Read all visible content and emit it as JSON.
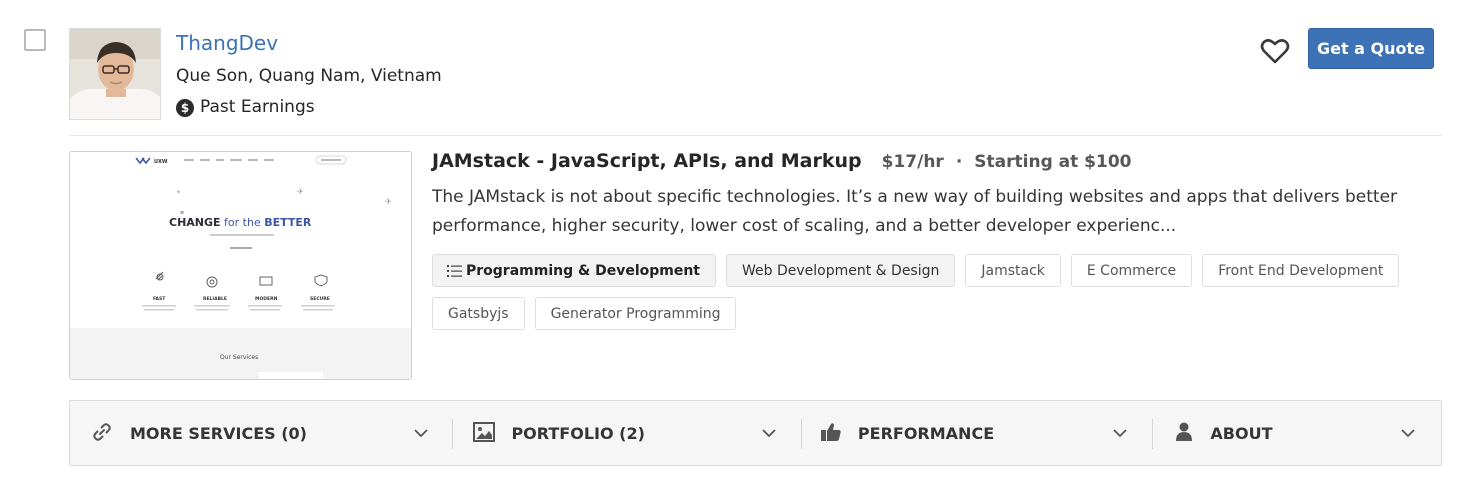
{
  "freelancer": {
    "name": "ThangDev",
    "location": "Que Son, Quang Nam, Vietnam",
    "earnings_label": "Past Earnings",
    "earnings_icon": "dollar-circle-icon"
  },
  "actions": {
    "favorite_icon": "heart-icon",
    "quote_label": "Get a Quote"
  },
  "service": {
    "title": "JAMstack - JavaScript, APIs, and Markup",
    "rate": "$17/hr",
    "separator": "·",
    "starting": "Starting at $100",
    "description": "The JAMstack is not about specific technologies. It’s a new way of building websites and apps that delivers better performance, higher security, lower cost of scaling, and a better developer experienc...",
    "thumbnail": {
      "logo": "UXW",
      "headline_a": "CHANGE",
      "headline_b": " for the ",
      "headline_c": "BETTER",
      "features": [
        "FAST",
        "RELIABLE",
        "MODERN",
        "SECURE"
      ],
      "section": "Our Services"
    }
  },
  "tags": [
    "Programming & Development",
    "Web Development & Design",
    "Jamstack",
    "E Commerce",
    "Front End Development",
    "Gatsbyjs",
    "Generator Programming"
  ],
  "bar": {
    "more_services": "MORE SERVICES (0)",
    "portfolio": "PORTFOLIO (2)",
    "performance": "PERFORMANCE",
    "about": "ABOUT"
  },
  "colors": {
    "link": "#3b73b9",
    "button": "#3d72b6",
    "accent_thumb": "#3f56a8"
  }
}
